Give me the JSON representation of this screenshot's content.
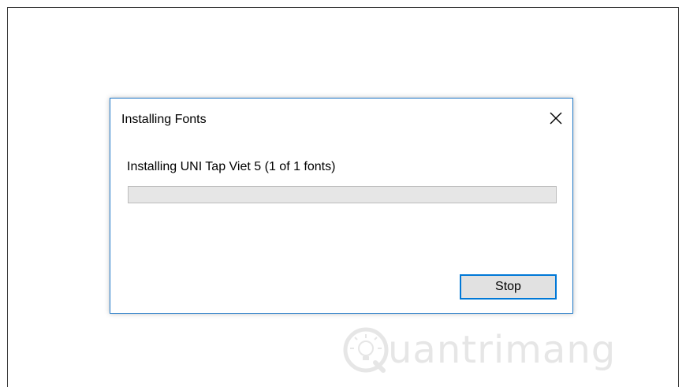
{
  "dialog": {
    "title": "Installing Fonts",
    "status_text": "Installing UNI Tap Viet 5 (1 of 1 fonts)",
    "progress_fraction": 0.0,
    "stop_label": "Stop"
  },
  "watermark": {
    "text": "uantrimang",
    "logo": "quantrimang-logo"
  },
  "colors": {
    "dialog_border": "#1e78c8",
    "button_focus_border": "#0078d7",
    "progress_track": "#e6e6e6"
  },
  "icons": {
    "close": "close-icon"
  }
}
